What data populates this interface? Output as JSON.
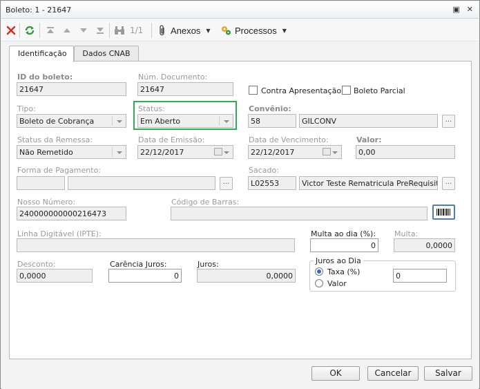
{
  "window": {
    "title": "Boleto: 1 - 21647",
    "restore_glyph": "▣",
    "close_glyph": "✕"
  },
  "toolbar": {
    "pager": "1/1",
    "anexos": "Anexos",
    "processos": "Processos",
    "icons": [
      "delete-icon",
      "refresh-icon",
      "first-record-icon",
      "previous-record-icon",
      "next-record-icon",
      "last-record-icon",
      "binoculars-icon",
      "paperclip-icon",
      "gears-icon"
    ],
    "accent_red": "#d9281c",
    "accent_green": "#2f9a3a"
  },
  "tabs": [
    "Identificação",
    "Dados CNAB"
  ],
  "form": {
    "id_boleto": {
      "label": "ID do boleto:",
      "value": "21647"
    },
    "num_documento": {
      "label": "Núm. Documento:",
      "value": "21647"
    },
    "contra_apresentacao": {
      "label": "Contra Apresentação",
      "checked": false
    },
    "boleto_parcial": {
      "label": "Boleto Parcial",
      "checked": false
    },
    "tipo": {
      "label": "Tipo:",
      "value": "Boleto de Cobrança"
    },
    "status": {
      "label": "Status:",
      "value": "Em Aberto",
      "highlight_color": "#2fae4f"
    },
    "convenio": {
      "label": "Convênio:",
      "code": "58",
      "name": "GILCONV"
    },
    "status_remessa": {
      "label": "Status da Remessa:",
      "value": "Não Remetido"
    },
    "data_emissao": {
      "label": "Data de Emissão:",
      "value": "22/12/2017"
    },
    "data_vencimento": {
      "label": "Data de Vencimento:",
      "value": "22/12/2017"
    },
    "valor": {
      "label": "Valor:",
      "value": "0,00"
    },
    "forma_pagamento": {
      "label": "Forma de Pagamento:",
      "code": "",
      "name": ""
    },
    "sacado": {
      "label": "Sacado:",
      "code": "L02553",
      "name": "Victor Teste Rematricula PreRequisito"
    },
    "nosso_numero": {
      "label": "Nosso Número:",
      "value": "240000000000216473"
    },
    "codigo_barras": {
      "label": "Código de Barras:",
      "value": ""
    },
    "linha_digitavel": {
      "label": "Linha Digitável (IPTE):",
      "value": ""
    },
    "multa_dia": {
      "label": "Multa ao dia (%):",
      "value": "0"
    },
    "multa": {
      "label": "Multa:",
      "value": "0,0000"
    },
    "desconto": {
      "label": "Desconto:",
      "value": "0,0000"
    },
    "carencia_juros": {
      "label": "Carência Juros:",
      "value": "0"
    },
    "juros": {
      "label": "Juros:",
      "value": "0,0000"
    },
    "juros_ao_dia": {
      "label": "Juros ao Dia",
      "options": [
        "Taxa (%)",
        "Valor"
      ],
      "selected": "Taxa (%)",
      "value": "0"
    },
    "browse_button": "..."
  },
  "footer": {
    "ok": "OK",
    "cancelar": "Cancelar",
    "salvar": "Salvar"
  }
}
